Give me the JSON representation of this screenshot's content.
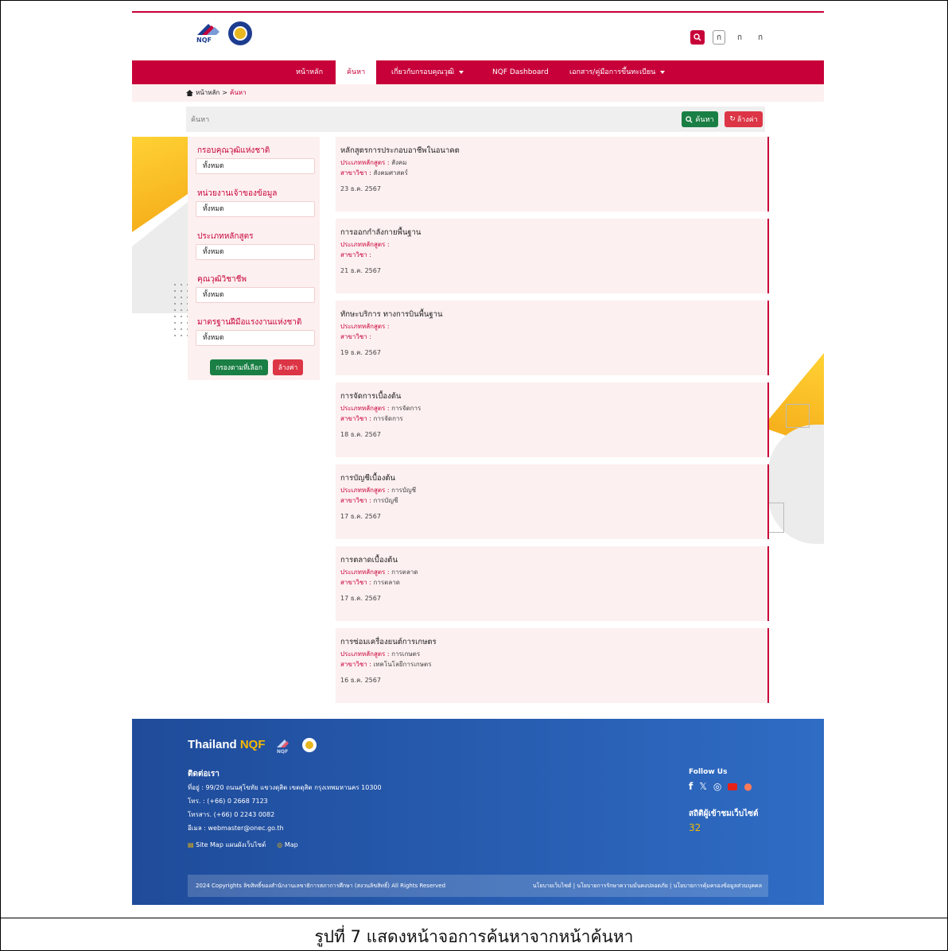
{
  "header": {
    "tools": {
      "size_small": "ก",
      "size_medium": "ก",
      "size_large": "ก"
    }
  },
  "nav": {
    "items": [
      "หน้าหลัก",
      "ค้นหา",
      "เกี่ยวกับกรอบคุณวุฒิ",
      "NQF Dashboard",
      "เอกสาร/คู่มือการขึ้นทะเบียน"
    ],
    "active": "ค้นหา"
  },
  "breadcrumb": {
    "home": "หน้าหลัก",
    "sep": ">",
    "current": "ค้นหา"
  },
  "search": {
    "placeholder": "ค้นหา",
    "search_label": "ค้นหา",
    "clear_label": "ล้างค่า"
  },
  "filters": {
    "groups": [
      {
        "label": "กรอบคุณวุฒิแห่งชาติ",
        "value": "ทั้งหมด"
      },
      {
        "label": "หน่วยงานเจ้าของข้อมูล",
        "value": "ทั้งหมด"
      },
      {
        "label": "ประเภทหลักสูตร",
        "value": "ทั้งหมด"
      },
      {
        "label": "คุณวุฒิวิชาชีพ",
        "value": "ทั้งหมด"
      },
      {
        "label": "มาตรฐานฝีมือแรงงานแห่งชาติ",
        "value": "ทั้งหมด"
      }
    ],
    "filter_label": "กรองตามที่เลือก",
    "reset_label": "ล้างค่า"
  },
  "results": {
    "type_label": "ประเภทหลักสูตร :",
    "field_label": "สาขาวิชา :",
    "items": [
      {
        "title": "หลักสูตรการประกอบอาชีพในอนาคต",
        "type": "สังคม",
        "field": "สังคมศาสตร์",
        "date": "23 ธ.ค. 2567"
      },
      {
        "title": "การออกกำลังกายพื้นฐาน",
        "type": "",
        "field": "",
        "date": "21 ธ.ค. 2567"
      },
      {
        "title": "ทักษะบริการ ทางการบินพื้นฐาน",
        "type": "",
        "field": "",
        "date": "19 ธ.ค. 2567"
      },
      {
        "title": "การจัดการเบื้องต้น",
        "type": "การจัดการ",
        "field": "การจัดการ",
        "date": "18 ธ.ค. 2567"
      },
      {
        "title": "การบัญชีเบื้องต้น",
        "type": "การบัญชี",
        "field": "การบัญชี",
        "date": "17 ธ.ค. 2567"
      },
      {
        "title": "การตลาดเบื้องต้น",
        "type": "การตลาด",
        "field": "การตลาด",
        "date": "17 ธ.ค. 2567"
      },
      {
        "title": "การซ่อมเครื่องยนต์การเกษตร",
        "type": "การเกษตร",
        "field": "เทคโนโลยีการเกษตร",
        "date": "16 ธ.ค. 2567"
      }
    ]
  },
  "footer": {
    "brand_main": "Thailand",
    "brand_accent": "NQF",
    "contact_title": "ติดต่อเรา",
    "address": "ที่อยู่ : 99/20 ถนนสุโขทัย แขวงดุสิต เขตดุสิต กรุงเทพมหานคร 10300",
    "phone": "โทร. : (+66) 0 2668 7123",
    "fax": "โทรสาร. (+66) 0 2243 0082",
    "email": "อีเมล : webmaster@onec.go.th",
    "sitemap": "Site Map แผนผังเว็บไซต์",
    "map": "Map",
    "follow": "Follow Us",
    "stats_title": "สถิติผู้เข้าชมเว็บไซต์",
    "stats_count": "32",
    "copyright": "2024 Copyrights ลิขสิทธิ์ของสำนักงานเลขาธิการสภาการศึกษา (สงวนลิขสิทธิ์) All Rights Reserved",
    "policies": "นโยบายเว็บไซต์ | นโยบายการรักษาความมั่นคงปลอดภัย | นโยบายการคุ้มครองข้อมูลส่วนบุคคล"
  },
  "caption": "รูปที่ 7 แสดงหน้าจอการค้นหาจากหน้าค้นหา",
  "colors": {
    "brand_red": "#c70039",
    "green": "#1a7f44",
    "danger": "#dc3545",
    "footer_blue": "#2f6cc4",
    "accent_yellow": "#f5b800"
  }
}
